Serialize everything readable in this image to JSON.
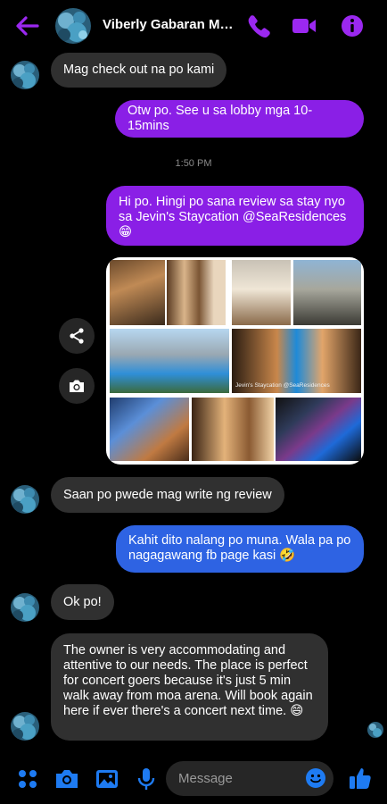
{
  "header": {
    "contact_name": "Viberly Gabaran Mon...",
    "back_icon": "arrow-left-icon",
    "call_icon": "phone-icon",
    "video_icon": "video-camera-icon",
    "info_icon": "info-icon"
  },
  "colors": {
    "accent": "#9b28f0",
    "outgoing_bubble": "#8a1fe6",
    "outgoing_bubble_alt": "#2e63e3",
    "incoming_bubble": "#303030",
    "composer_icon": "#1e7bf2"
  },
  "messages": [
    {
      "id": 1,
      "direction": "incoming",
      "text": "Mag check out na po kami"
    },
    {
      "id": 2,
      "direction": "outgoing",
      "text": "Otw po. See u sa lobby mga 10-15mins"
    },
    {
      "id": 3,
      "direction": "outgoing",
      "text": "Hi po. Hingi po sana review sa stay nyo sa Jevin's Staycation @SeaResidences 😁"
    },
    {
      "id": 4,
      "direction": "incoming",
      "text": "Saan po pwede mag write ng review"
    },
    {
      "id": 5,
      "direction": "outgoing",
      "text": "Kahit dito nalang po muna. Wala pa po nagagawang fb page kasi 🤣"
    },
    {
      "id": 6,
      "direction": "incoming",
      "text": "Ok po!"
    },
    {
      "id": 7,
      "direction": "incoming",
      "text": "The owner is very accommodating and attentive to our needs. The place is perfect for concert goers because it's just 5 min walk away from moa arena.  Will book again here if ever there's a concert next time. 😄"
    }
  ],
  "timestamp": "1:50 PM",
  "photo_collage": {
    "caption": "Jevin's Staycation @SeaResidences",
    "share_icon": "share-icon",
    "camera_icon": "camera-icon"
  },
  "composer": {
    "placeholder": "Message",
    "icons": [
      "apps-grid-icon",
      "camera-icon",
      "gallery-icon",
      "microphone-icon",
      "emoji-icon",
      "thumbs-up-icon"
    ]
  }
}
